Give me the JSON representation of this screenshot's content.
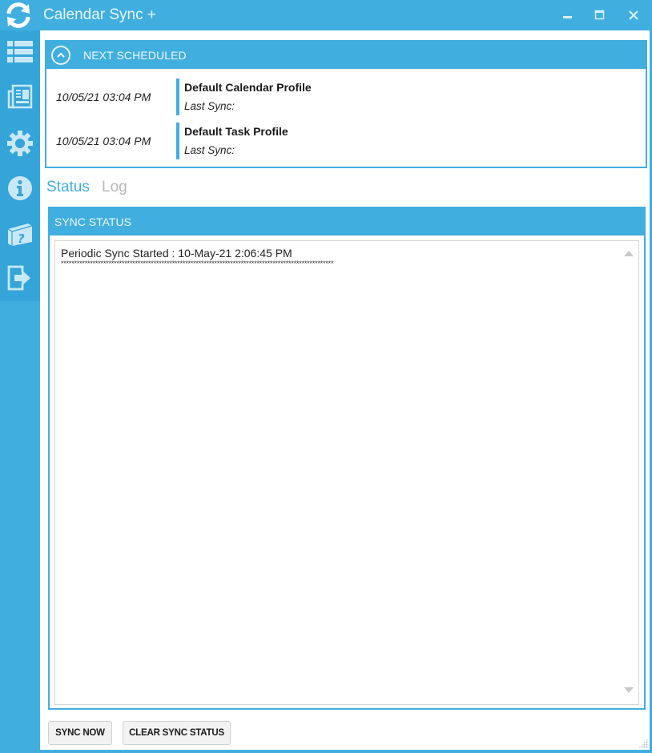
{
  "window": {
    "title": "Calendar Sync +",
    "controls": [
      "minimize",
      "maximize",
      "close"
    ]
  },
  "sidebar": {
    "items": [
      {
        "icon": "list-icon",
        "label": "Profiles"
      },
      {
        "icon": "newspaper-icon",
        "label": "Log"
      },
      {
        "icon": "gear-icon",
        "label": "Settings"
      },
      {
        "icon": "info-icon",
        "label": "About"
      },
      {
        "icon": "help-book-icon",
        "label": "Help"
      },
      {
        "icon": "exit-icon",
        "label": "Exit"
      }
    ]
  },
  "next_scheduled": {
    "title": "NEXT SCHEDULED",
    "items": [
      {
        "date": "10/05/21 03:04 PM",
        "profile": "Default Calendar Profile",
        "last_sync": "Last Sync:"
      },
      {
        "date": "10/05/21 03:04 PM",
        "profile": "Default Task Profile",
        "last_sync": "Last Sync:"
      }
    ]
  },
  "tabs": [
    {
      "label": "Status",
      "active": true
    },
    {
      "label": "Log",
      "active": false
    }
  ],
  "sync_status": {
    "title": "SYNC STATUS",
    "lines": [
      "Periodic Sync Started : 10-May-21 2:06:45 PM",
      "*******************************************************************************************************"
    ]
  },
  "buttons": {
    "sync_now": "SYNC NOW",
    "clear_sync_status": "CLEAR SYNC STATUS"
  },
  "colors": {
    "accent": "#41aee0",
    "sidebar_dark": "#35a5d9",
    "tab_inactive": "#b8b8b8"
  }
}
